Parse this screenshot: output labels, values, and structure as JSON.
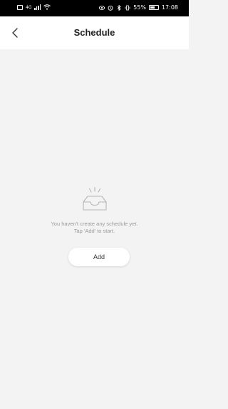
{
  "status_bar": {
    "net_label": "4G",
    "battery_percent": "55%",
    "time": "17:08"
  },
  "header": {
    "title": "Schedule"
  },
  "empty_state": {
    "line1": "You haven't create any schedule yet.",
    "line2": "Tap 'Add' to start."
  },
  "actions": {
    "add_label": "Add"
  },
  "colors": {
    "page_background": "#f3f3f3",
    "header_background": "#ffffff",
    "muted_text": "#9a9a9a",
    "icon_stroke": "#b5b5b5"
  }
}
